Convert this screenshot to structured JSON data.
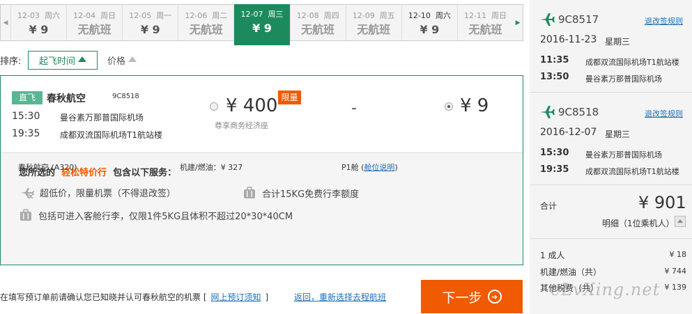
{
  "date_strip": {
    "days": [
      {
        "date": "12-03",
        "weekday": "周六",
        "price": "¥ 9"
      },
      {
        "date": "12-04",
        "weekday": "周日",
        "price": "无航班"
      },
      {
        "date": "12-05",
        "weekday": "周一",
        "price": "¥ 9"
      },
      {
        "date": "12-06",
        "weekday": "周二",
        "price": "无航班"
      },
      {
        "date": "12-07",
        "weekday": "周三",
        "price": "¥ 9"
      },
      {
        "date": "12-08",
        "weekday": "周四",
        "price": "无航班"
      },
      {
        "date": "12-09",
        "weekday": "周五",
        "price": "无航班"
      },
      {
        "date": "12-10",
        "weekday": "周六",
        "price": "¥ 9"
      },
      {
        "date": "12-11",
        "weekday": "周日",
        "price": "无航班"
      }
    ]
  },
  "sort": {
    "label": "排序:",
    "departure_time": "起飞时间",
    "price": "价格"
  },
  "flight": {
    "tag": "直飞",
    "airline": "春秋航空",
    "flight_no": "9C8518",
    "dep_time": "15:30",
    "dep_airport": "曼谷素万那普国际机场",
    "arr_time": "19:35",
    "arr_airport": "成都双流国际机场T1航站楼",
    "price_option_1": "¥ 400",
    "limit_tag": "限量",
    "cabin": "尊享商务经济座",
    "dash": "-",
    "price_option_2": "¥ 9"
  },
  "services": {
    "title_prefix": "您所选的",
    "title_highlight": "轻松特价行",
    "title_suffix": "包含以下服务：",
    "item_lowprice": "超低价，限量机票（不得退改签）",
    "item_baggage": "合计15KG免费行李额度",
    "item_cabin_bag": "包括可进入客舱行李，仅限1件5KG且体积不超过20*30*40CM",
    "aircraft": "春秋航空 (A320)",
    "fuel": "机建/燃油：¥ 327",
    "class": "P1舱",
    "class_link": "舱位说明"
  },
  "footer": {
    "notice": "在填写预订单前请确认您已知晓并认可春秋航空的机票 [",
    "notice_link": "网上预订须知",
    "notice_end": "]",
    "reselect": "返回，重新选择去程航班",
    "next": "下一步"
  },
  "summary": {
    "segments": [
      {
        "flight_no": "9C8517",
        "rule": "退改签规则",
        "date": "2016-11-23",
        "weekday": "星期三",
        "dep_time": "11:35",
        "dep_airport": "成都双流国际机场T1航站楼",
        "arr_time": "13:50",
        "arr_airport": "曼谷素万那普国际机场"
      },
      {
        "flight_no": "9C8518",
        "rule": "退改签规则",
        "date": "2016-12-07",
        "weekday": "星期三",
        "dep_time": "15:30",
        "dep_airport": "曼谷素万那普国际机场",
        "arr_time": "19:35",
        "arr_airport": "成都双流国际机场T1航站楼"
      }
    ],
    "total_label": "合计",
    "total_value": "¥ 901",
    "detail": "明细（1位乘机人）",
    "fees": [
      {
        "label": "1 成人",
        "value": "¥ 18"
      },
      {
        "label": "机建/燃油（共）",
        "value": "¥ 744"
      },
      {
        "label": "其他税费（共）",
        "value": "¥ 139"
      }
    ],
    "watermark": "eLvXing.net"
  },
  "colors": {
    "brand_green": "#1d8a5e",
    "accent_orange": "#f05a00",
    "link_blue": "#1d6fb8"
  },
  "icons": {
    "plane": "plane-icon",
    "baggage": "suitcase-icon",
    "arrow": "circle-arrow-right-icon"
  }
}
